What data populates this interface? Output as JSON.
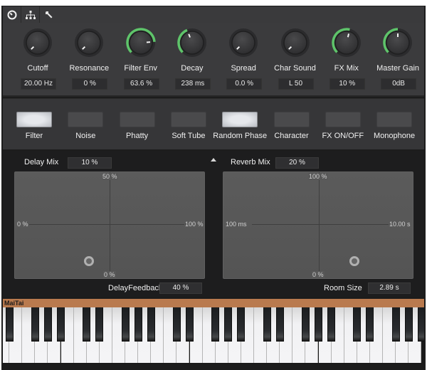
{
  "tabs": [
    {
      "name": "dashboard-icon",
      "label": "Controls"
    },
    {
      "name": "hierarchy-icon",
      "label": "Routing"
    },
    {
      "name": "wrench-icon",
      "label": "Settings"
    }
  ],
  "accent_color": "#5ec46a",
  "knobs": [
    {
      "id": "cutoff",
      "label": "Cutoff",
      "value": "20.00 Hz",
      "fraction": 0.0
    },
    {
      "id": "resonance",
      "label": "Resonance",
      "value": "0 %",
      "fraction": 0.0
    },
    {
      "id": "filter-env",
      "label": "Filter Env",
      "value": "63.6 %",
      "fraction": 0.82
    },
    {
      "id": "decay",
      "label": "Decay",
      "value": "238 ms",
      "fraction": 0.42
    },
    {
      "id": "spread",
      "label": "Spread",
      "value": "0.0 %",
      "fraction": 0.0
    },
    {
      "id": "char-sound",
      "label": "Char Sound",
      "value": "L 50",
      "fraction": 0.0
    },
    {
      "id": "fx-mix",
      "label": "FX Mix",
      "value": "10 %",
      "fraction": 0.55
    },
    {
      "id": "master-gain",
      "label": "Master Gain",
      "value": "0dB",
      "fraction": 0.5
    }
  ],
  "toggles": [
    {
      "id": "filter",
      "label": "Filter",
      "on": true
    },
    {
      "id": "noise",
      "label": "Noise",
      "on": false
    },
    {
      "id": "phatty",
      "label": "Phatty",
      "on": false
    },
    {
      "id": "soft-tube",
      "label": "Soft Tube",
      "on": false
    },
    {
      "id": "random-phase",
      "label": "Random Phase",
      "on": true
    },
    {
      "id": "character",
      "label": "Character",
      "on": false
    },
    {
      "id": "fx-on-off",
      "label": "FX ON/OFF",
      "on": false
    },
    {
      "id": "monophone",
      "label": "Monophone",
      "on": false
    }
  ],
  "delay": {
    "mix_label": "Delay Mix",
    "mix_value": "10 %",
    "feedback_label": "DelayFeedback",
    "feedback_value": "40 %",
    "axis_top": "50 %",
    "axis_bottom": "0 %",
    "axis_left": "0 %",
    "axis_right": "100 %",
    "handle_x": 0.39,
    "handle_y": 0.16
  },
  "reverb": {
    "mix_label": "Reverb Mix",
    "mix_value": "20 %",
    "size_label": "Room Size",
    "size_value": "2.89 s",
    "axis_top": "100 %",
    "axis_bottom": "0 %",
    "axis_left": "100 ms",
    "axis_right": "10.00 s",
    "handle_x": 0.69,
    "handle_y": 0.16
  },
  "keyboard": {
    "title": "MaiTai",
    "white_key_count": 33
  }
}
